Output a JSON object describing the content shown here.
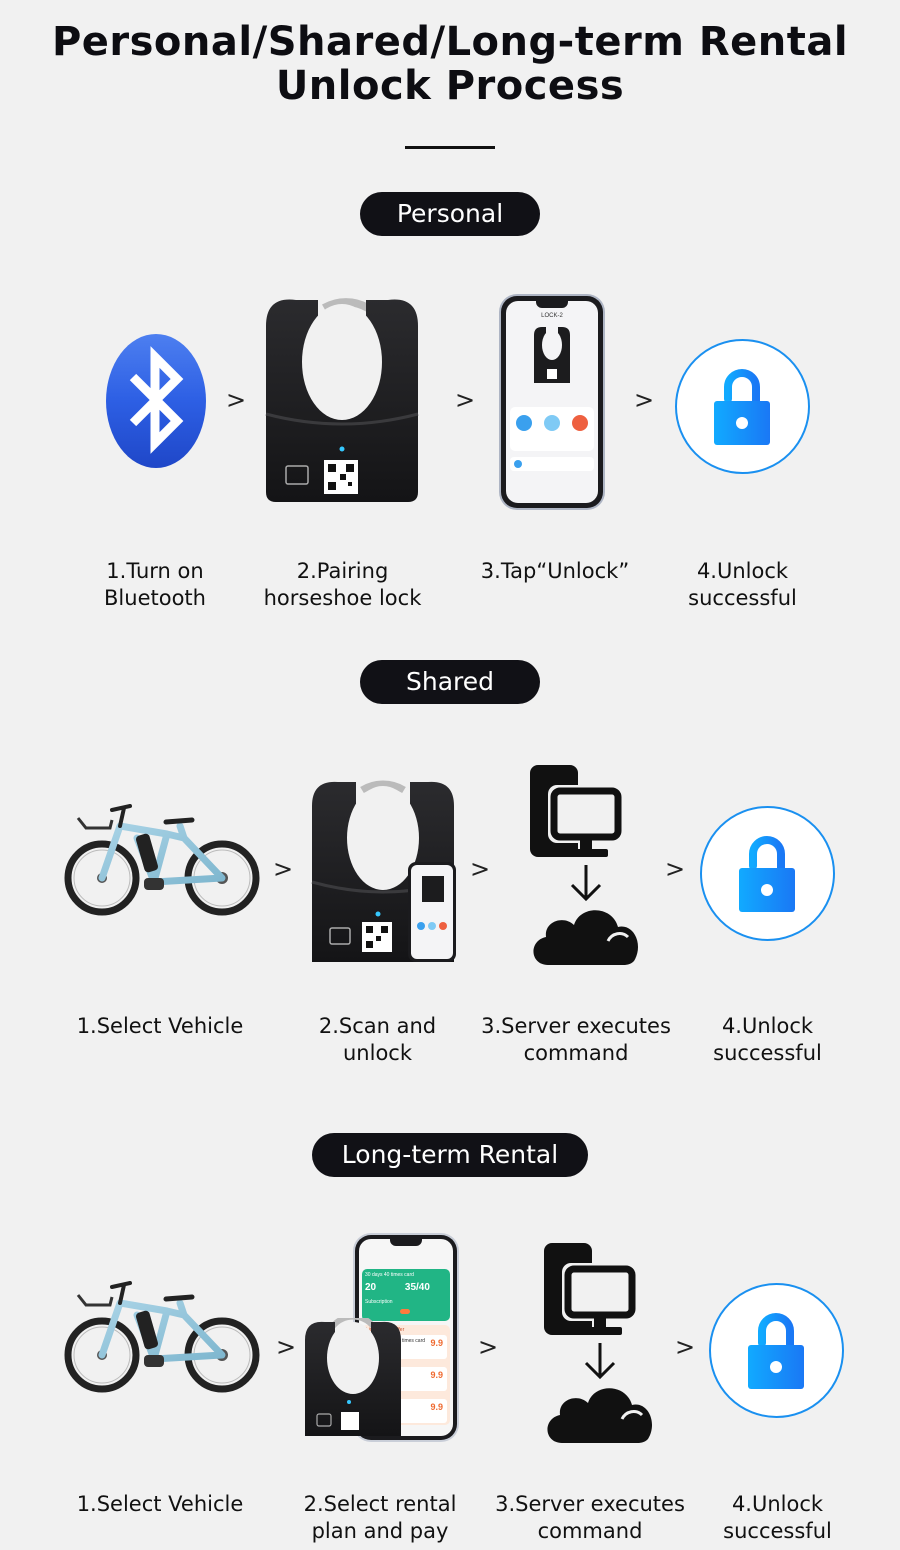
{
  "header": {
    "title_line1": "Personal/Shared/Long-term Rental",
    "title_line2": "Unlock Process"
  },
  "colors": {
    "background": "#f1f1f1",
    "pill": "#111116",
    "accent_blue": "#1a90f0",
    "bluetooth_blue": "#2a63e6"
  },
  "sections": [
    {
      "pill": "Personal",
      "steps": [
        {
          "label": "1.Turn on\nBluetooth",
          "icon": "bluetooth-icon"
        },
        {
          "label": "2.Pairing\nhorseshoe lock",
          "icon": "horseshoe-lock-image"
        },
        {
          "label": "3.Tap“Unlock”",
          "icon": "phone-app-image"
        },
        {
          "label": "4.Unlock\nsuccessful",
          "icon": "unlock-icon"
        }
      ],
      "phone_screen_title": "LOCK-2"
    },
    {
      "pill": "Shared",
      "steps": [
        {
          "label": "1.Select Vehicle",
          "icon": "ebike-image"
        },
        {
          "label": "2.Scan and\nunlock",
          "icon": "lock-with-phone-image"
        },
        {
          "label": "3.Server executes\ncommand",
          "icon": "server-cloud-icon"
        },
        {
          "label": "4.Unlock\nsuccessful",
          "icon": "unlock-icon"
        }
      ]
    },
    {
      "pill": "Long-term Rental",
      "steps": [
        {
          "label": "1.Select Vehicle",
          "icon": "ebike-image"
        },
        {
          "label": "2.Select rental\nplan and pay",
          "icon": "rental-app-image"
        },
        {
          "label": "3.Server executes\ncommand",
          "icon": "server-cloud-icon"
        },
        {
          "label": "4.Unlock\nsuccessful",
          "icon": "unlock-icon"
        }
      ],
      "app": {
        "card_title": "30 days 40 times card",
        "remaining_days": "20",
        "remaining_times": "35/40",
        "subscription_label": "Subscription",
        "offer_label": "Limited time offer",
        "plan_name": "30 times card",
        "price": "9.9"
      }
    }
  ],
  "chevron": ">"
}
